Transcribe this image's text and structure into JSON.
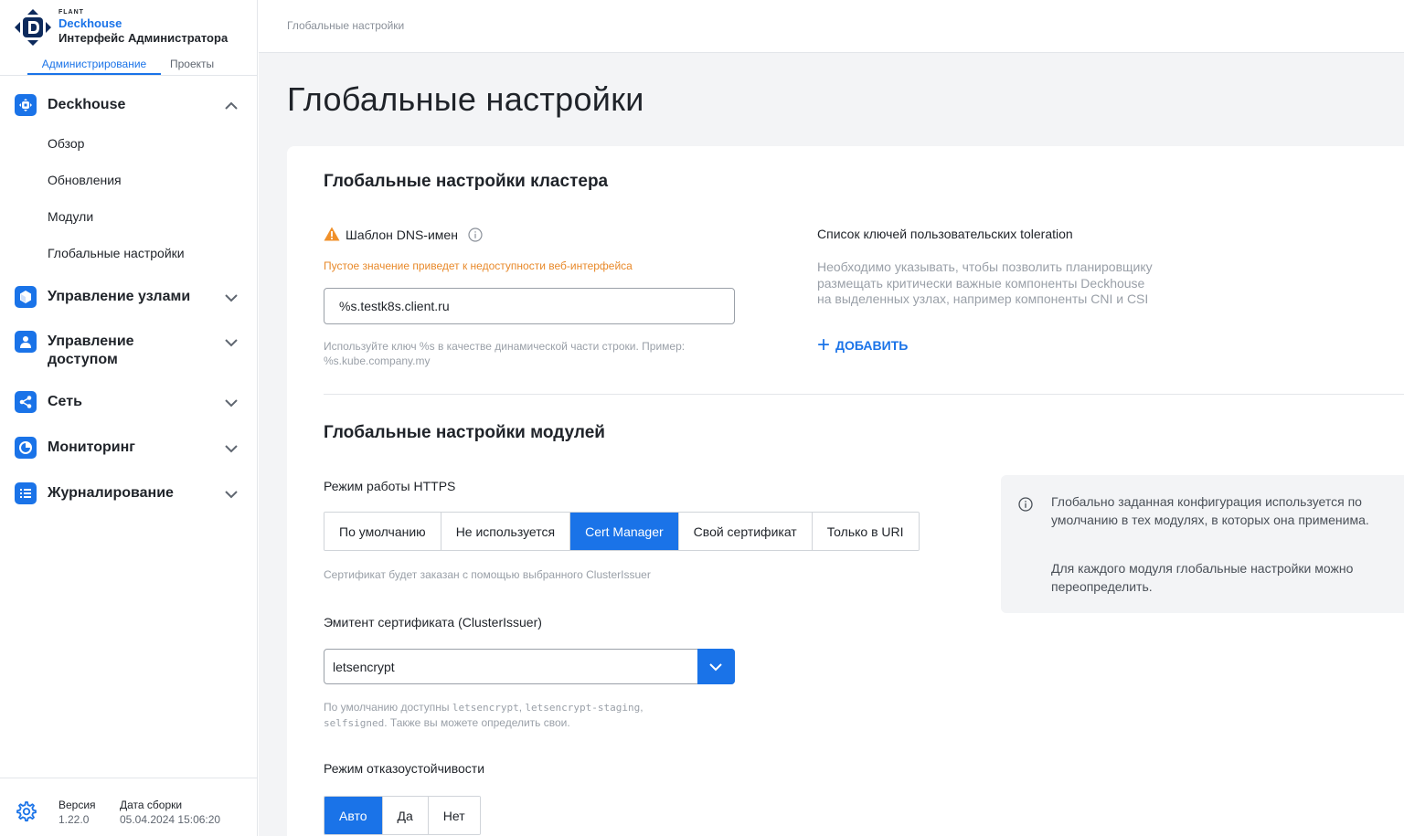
{
  "brand": {
    "company": "FLANT",
    "product": "Deckhouse",
    "subtitle": "Интерфейс Администратора"
  },
  "top_tabs": [
    {
      "label": "Администрирование",
      "active": true
    },
    {
      "label": "Проекты",
      "active": false
    }
  ],
  "nav": {
    "deckhouse": {
      "label": "Deckhouse",
      "expanded": true,
      "items": [
        "Обзор",
        "Обновления",
        "Модули",
        "Глобальные настройки"
      ]
    },
    "nodes": {
      "label": "Управление узлами"
    },
    "access": {
      "label_line1": "Управление",
      "label_line2": "доступом"
    },
    "network": {
      "label": "Сеть"
    },
    "monitoring": {
      "label": "Мониторинг"
    },
    "logging": {
      "label": "Журналирование"
    }
  },
  "footer": {
    "version_label": "Версия",
    "version_value": "1.22.0",
    "build_label": "Дата сборки",
    "build_value": "05.04.2024 15:06:20"
  },
  "breadcrumb": "Глобальные настройки",
  "page_title": "Глобальные настройки",
  "cluster": {
    "title": "Глобальные настройки кластера",
    "dns": {
      "label": "Шаблон DNS-имен",
      "warning": "Пустое значение приведет к недоступности веб-интерфейса",
      "value": "%s.testk8s.client.ru",
      "hint_line1": "Используйте ключ %s в качестве динамической части строки. Пример:",
      "hint_line2": "%s.kube.company.my"
    },
    "tolerations": {
      "title": "Список ключей пользовательских toleration",
      "desc_line1": "Необходимо указывать, чтобы позволить планировщику",
      "desc_line2": "размещать критически важные компоненты Deckhouse",
      "desc_line3": "на выделенных узлах, например компоненты CNI и CSI",
      "add_label": "ДОБАВИТЬ"
    }
  },
  "modules": {
    "title": "Глобальные настройки модулей",
    "https": {
      "label": "Режим работы HTTPS",
      "options": [
        "По умолчанию",
        "Не используется",
        "Cert Manager",
        "Свой сертификат",
        "Только в URI"
      ],
      "selected": "Cert Manager",
      "hint": "Сертификат будет заказан с помощью выбранного ClusterIssuer"
    },
    "issuer": {
      "label": "Эмитент сертификата (ClusterIssuer)",
      "value": "letsencrypt",
      "hint_prefix": "По умолчанию доступны ",
      "hint_code1": "letsencrypt",
      "hint_sep": ", ",
      "hint_code2": "letsencrypt-staging",
      "hint_comma": ",",
      "hint_code3": "selfsigned",
      "hint_suffix": ". Также вы можете определить свои."
    },
    "ha": {
      "label": "Режим отказоустойчивости",
      "options": [
        "Авто",
        "Да",
        "Нет"
      ],
      "selected": "Авто"
    },
    "info": {
      "p1": "Глобально заданная конфигурация используется по умолчанию в тех модулях, в которых она применима.",
      "p2": "Для каждого модуля глобальные настройки можно переопределить."
    }
  },
  "colors": {
    "accent": "#1a73e8",
    "warning": "#e8892a"
  }
}
